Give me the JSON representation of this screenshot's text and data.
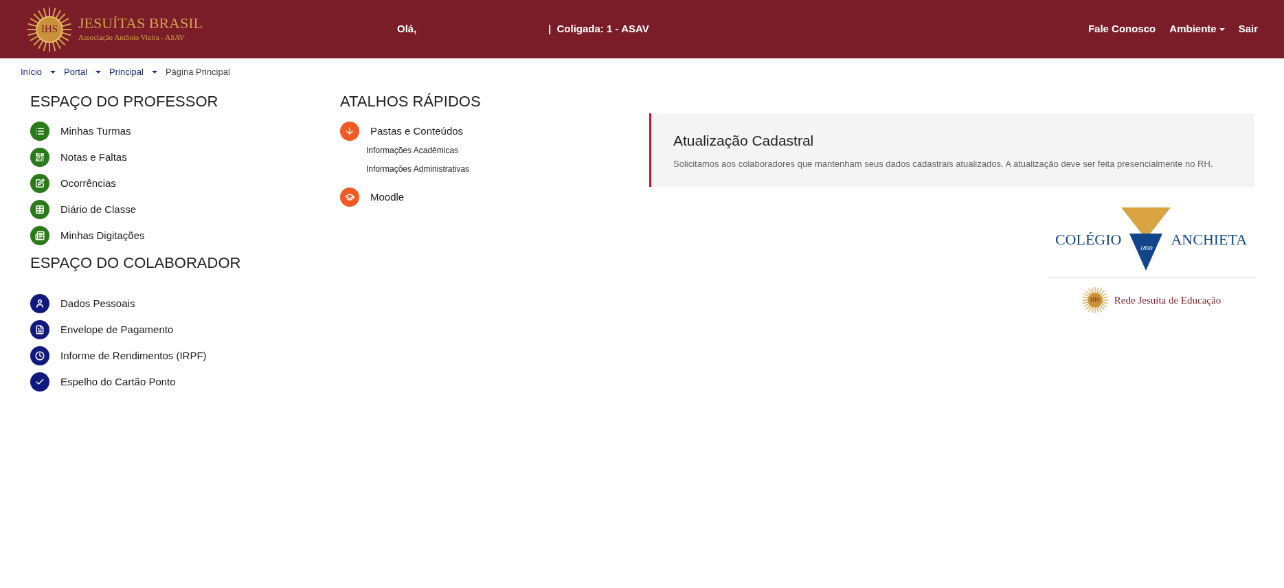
{
  "header": {
    "logo": {
      "seal": "IHS",
      "title": "JESUÍTAS BRASIL",
      "subtitle": "Associação Antônio Vieira - ASAV"
    },
    "greeting": "Olá,",
    "coligada": "|  Coligada: 1 - ASAV",
    "nav": [
      {
        "label": "Fale Conosco",
        "dropdown": false
      },
      {
        "label": "Ambiente",
        "dropdown": true
      },
      {
        "label": "Sair",
        "dropdown": false
      }
    ]
  },
  "breadcrumb": [
    {
      "label": "Início",
      "link": true
    },
    {
      "label": "Portal",
      "link": true
    },
    {
      "label": "Principal",
      "link": true
    },
    {
      "label": "Página Principal",
      "link": false
    }
  ],
  "professor": {
    "title": "ESPAÇO DO PROFESSOR",
    "items": [
      "Minhas Turmas",
      "Notas e Faltas",
      "Ocorrências",
      "Diário de Classe",
      "Minhas Digitações"
    ]
  },
  "colaborador": {
    "title": "ESPAÇO DO COLABORADOR",
    "items": [
      "Dados Pessoais",
      "Envelope de Pagamento",
      "Informe de Rendimentos (IRPF)",
      "Espelho do Cartão Ponto"
    ]
  },
  "atalhos": {
    "title": "ATALHOS RÁPIDOS",
    "items": [
      {
        "label": "Pastas e Conteúdos",
        "children": [
          "Informações Acadêmicas",
          "Informações Administrativas"
        ]
      },
      {
        "label": "Moodle"
      }
    ]
  },
  "notice": {
    "title": "Atualização Cadastral",
    "text": "Solicitamos aos colaboradores que mantenham seus dados cadastrais atualizados. A atualização deve ser feita presencialmente no RH."
  },
  "school_logo": {
    "left": "COLÉGIO",
    "right": "ANCHIETA",
    "year": "1890",
    "seal": "IHS",
    "network": "Rede Jesuita de Educação"
  }
}
